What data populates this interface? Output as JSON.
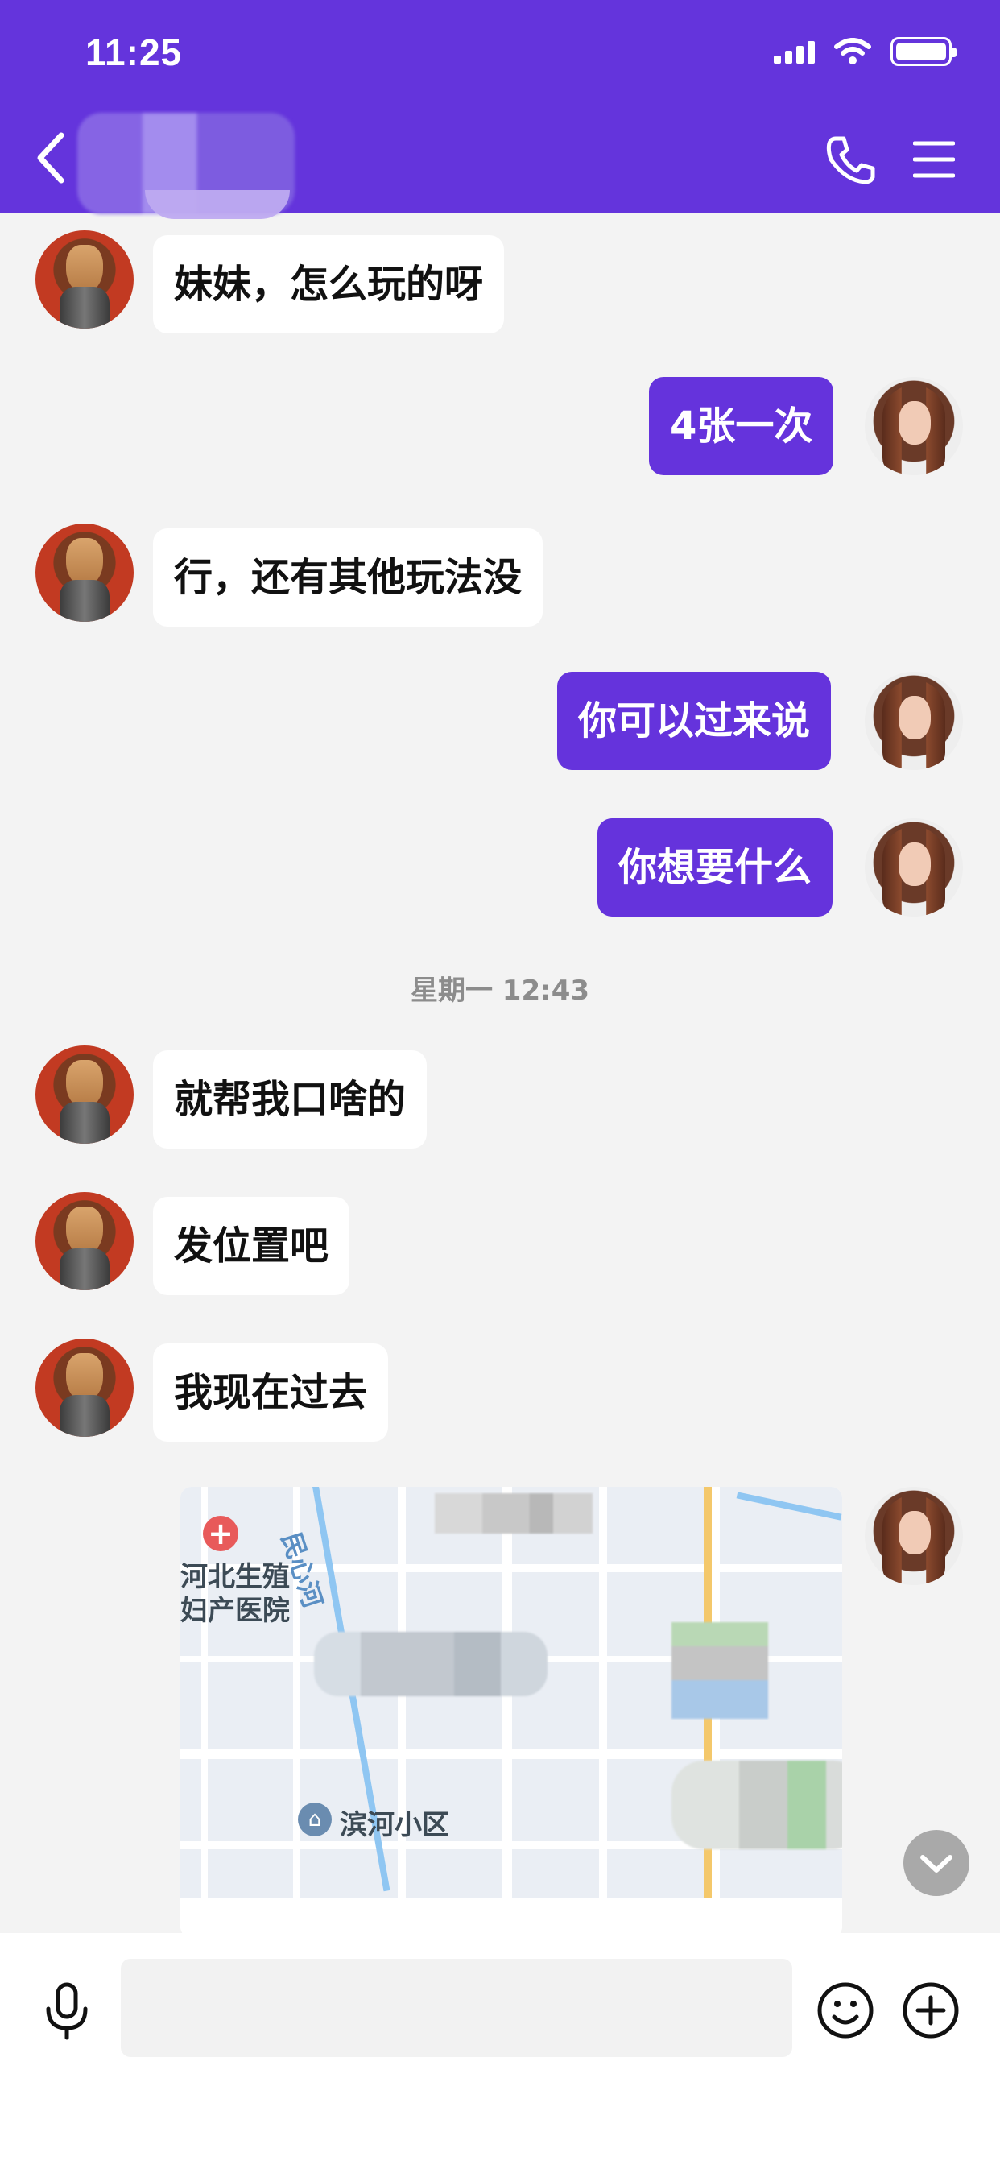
{
  "status_bar": {
    "time": "11:25"
  },
  "header": {
    "back_icon": "chevron-left-icon",
    "call_icon": "phone-icon",
    "menu_icon": "hamburger-menu-icon",
    "background_color": "#6434dc"
  },
  "messages": [
    {
      "side": "in",
      "text": "妹妹，怎么玩的呀"
    },
    {
      "side": "out",
      "text": "4张一次"
    },
    {
      "side": "in",
      "text": "行，还有其他玩法没"
    },
    {
      "side": "out",
      "text": "你可以过来说"
    },
    {
      "side": "out",
      "text": "你想要什么"
    },
    {
      "side": "in",
      "text": "就帮我口啥的"
    },
    {
      "side": "in",
      "text": "发位置吧"
    },
    {
      "side": "in",
      "text": "我现在过去"
    }
  ],
  "timestamp": "星期一 12:43",
  "location_message": {
    "side": "out",
    "map_labels": {
      "river": "民心河",
      "hospital_line1": "河北生殖",
      "hospital_line2": "妇产医院",
      "community": "滨河小区"
    }
  },
  "input_bar": {
    "placeholder": "",
    "mic_icon": "microphone-icon",
    "emoji_icon": "smiley-icon",
    "plus_icon": "plus-circle-icon"
  },
  "colors": {
    "accent": "#6533dc",
    "incoming_bubble": "#ffffff",
    "chat_background": "#f3f3f3"
  }
}
